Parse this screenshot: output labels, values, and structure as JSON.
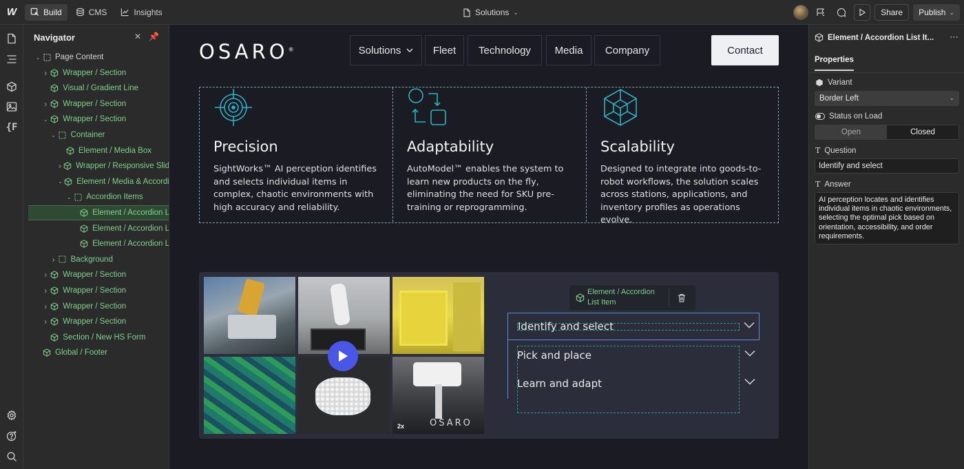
{
  "topbar": {
    "tabs": [
      {
        "label": "Build",
        "icon": "build-icon",
        "active": true
      },
      {
        "label": "CMS",
        "icon": "database-icon",
        "active": false
      },
      {
        "label": "Insights",
        "icon": "chart-icon",
        "active": false
      }
    ],
    "page_selector": "Solutions",
    "share_label": "Share",
    "publish_label": "Publish"
  },
  "rail": {
    "icons": [
      "pages-icon",
      "navigator-icon",
      "components-icon",
      "assets-icon",
      "variables-icon",
      "settings-icon",
      "help-icon",
      "search-icon"
    ]
  },
  "navigator": {
    "title": "Navigator",
    "items": [
      {
        "label": "Page Content",
        "depth": 0,
        "kind": "box",
        "color": "grey",
        "caret": "open"
      },
      {
        "label": "Wrapper / Section",
        "depth": 1,
        "kind": "component",
        "color": "green",
        "caret": "closed"
      },
      {
        "label": "Visual / Gradient Line",
        "depth": 1,
        "kind": "component",
        "color": "green",
        "caret": "none"
      },
      {
        "label": "Wrapper / Section",
        "depth": 1,
        "kind": "component",
        "color": "green",
        "caret": "closed"
      },
      {
        "label": "Wrapper / Section",
        "depth": 1,
        "kind": "component",
        "color": "green",
        "caret": "open"
      },
      {
        "label": "Container",
        "depth": 2,
        "kind": "box",
        "color": "green",
        "caret": "open"
      },
      {
        "label": "Element / Media Box",
        "depth": 3,
        "kind": "component",
        "color": "green",
        "caret": "none"
      },
      {
        "label": "Wrapper / Responsive Slid",
        "depth": 3,
        "kind": "component",
        "color": "green",
        "caret": "closed"
      },
      {
        "label": "Element / Media & Accordi",
        "depth": 3,
        "kind": "component",
        "color": "green",
        "caret": "open"
      },
      {
        "label": "Accordion Items",
        "depth": 4,
        "kind": "box",
        "color": "green",
        "caret": "open"
      },
      {
        "label": "Element / Accordion L",
        "depth": 5,
        "kind": "component",
        "color": "green",
        "caret": "none",
        "selected": true
      },
      {
        "label": "Element / Accordion L",
        "depth": 5,
        "kind": "component",
        "color": "green",
        "caret": "none"
      },
      {
        "label": "Element / Accordion L",
        "depth": 5,
        "kind": "component",
        "color": "green",
        "caret": "none"
      },
      {
        "label": "Background",
        "depth": 2,
        "kind": "box",
        "color": "green",
        "caret": "closed"
      },
      {
        "label": "Wrapper / Section",
        "depth": 1,
        "kind": "component",
        "color": "green",
        "caret": "closed"
      },
      {
        "label": "Wrapper / Section",
        "depth": 1,
        "kind": "component",
        "color": "green",
        "caret": "closed"
      },
      {
        "label": "Wrapper / Section",
        "depth": 1,
        "kind": "component",
        "color": "green",
        "caret": "closed"
      },
      {
        "label": "Wrapper / Section",
        "depth": 1,
        "kind": "component",
        "color": "green",
        "caret": "closed"
      },
      {
        "label": "Section / New HS Form",
        "depth": 1,
        "kind": "component",
        "color": "green",
        "caret": "none"
      },
      {
        "label": "Global / Footer",
        "depth": 0,
        "kind": "component",
        "color": "green",
        "caret": "none"
      }
    ]
  },
  "site": {
    "logo": "OSARO",
    "menu": [
      "Solutions",
      "Fleet",
      "Technology",
      "Media",
      "Company"
    ],
    "contact_label": "Contact",
    "features": [
      {
        "title": "Precision",
        "text": "SightWorks™ AI perception identifies and selects individual items in complex, chaotic environments with high accuracy and reliability.",
        "icon": "target-icon"
      },
      {
        "title": "Adaptability",
        "text": "AutoModel™ enables the system to learn new products on the fly, eliminating the need for SKU pre-training or reprogramming.",
        "icon": "flow-icon"
      },
      {
        "title": "Scalability",
        "text": "Designed to integrate into goods-to-robot workflows, the solution scales across stations, applications, and inventory profiles as operations evolve.",
        "icon": "cube-network-icon"
      }
    ],
    "video": {
      "speed": "2x",
      "watermark": "OSARO"
    },
    "accordion_tag": "Element / Accordion List Item",
    "accordion": [
      {
        "label": "Identify and select",
        "active": true
      },
      {
        "label": "Pick and place",
        "active": false
      },
      {
        "label": "Learn and adapt",
        "active": false
      }
    ]
  },
  "properties": {
    "title": "Element / Accordion List It...",
    "tab": "Properties",
    "variant_label": "Variant",
    "variant_value": "Border Left",
    "status_label": "Status on Load",
    "status_options": [
      "Open",
      "Closed"
    ],
    "status_selected": "Closed",
    "question_label": "Question",
    "question_value": "Identify and select",
    "answer_label": "Answer",
    "answer_value": "AI perception locates and identifies individual items in chaotic environments, selecting the optimal pick based on orientation, accessibility, and order requirements."
  },
  "colors": {
    "component_green": "#7fd18b",
    "play_button": "#4a56e6",
    "active_accordion_border": "#5a8edc",
    "feature_icon": "#2bb3c6"
  }
}
